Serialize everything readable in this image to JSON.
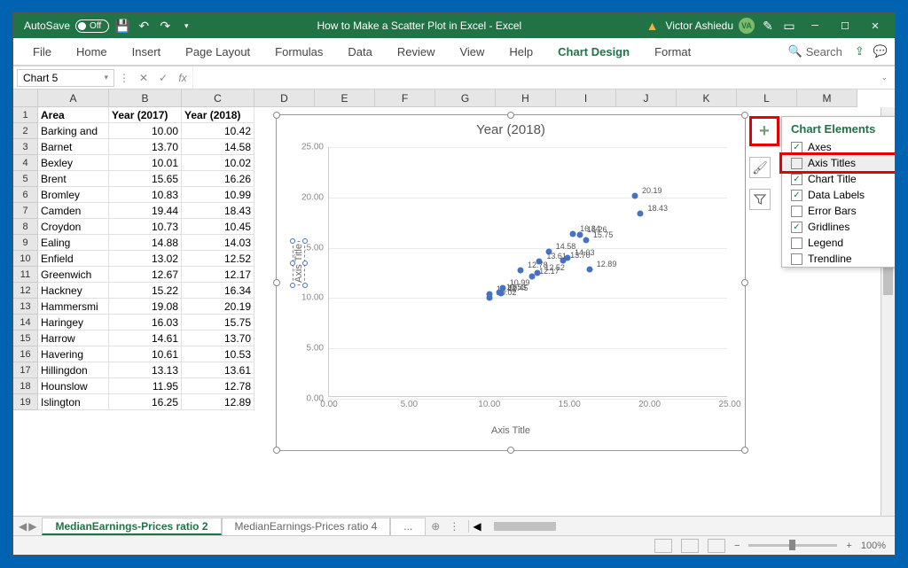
{
  "titlebar": {
    "autosave_label": "AutoSave",
    "autosave_state": "Off",
    "document_title": "How to Make a Scatter Plot in Excel  -  Excel",
    "user_name": "Victor Ashiedu",
    "user_initials": "VA"
  },
  "ribbon": {
    "tabs": [
      "File",
      "Home",
      "Insert",
      "Page Layout",
      "Formulas",
      "Data",
      "Review",
      "View",
      "Help",
      "Chart Design",
      "Format"
    ],
    "active_index": 9,
    "search_label": "Search"
  },
  "formulabar": {
    "namebox": "Chart 5"
  },
  "columns": [
    "",
    "A",
    "B",
    "C",
    "D",
    "E",
    "F",
    "G",
    "H",
    "I",
    "J",
    "K",
    "L",
    "M"
  ],
  "table": {
    "headers": [
      "Area",
      "Year (2017)",
      "Year (2018)"
    ],
    "rows": [
      [
        "Barking and",
        "10.00",
        "10.42"
      ],
      [
        "Barnet",
        "13.70",
        "14.58"
      ],
      [
        "Bexley",
        "10.01",
        "10.02"
      ],
      [
        "Brent",
        "15.65",
        "16.26"
      ],
      [
        "Bromley",
        "10.83",
        "10.99"
      ],
      [
        "Camden",
        "19.44",
        "18.43"
      ],
      [
        "Croydon",
        "10.73",
        "10.45"
      ],
      [
        "Ealing",
        "14.88",
        "14.03"
      ],
      [
        "Enfield",
        "13.02",
        "12.52"
      ],
      [
        "Greenwich",
        "12.67",
        "12.17"
      ],
      [
        "Hackney",
        "15.22",
        "16.34"
      ],
      [
        "Hammersmi",
        "19.08",
        "20.19"
      ],
      [
        "Haringey",
        "16.03",
        "15.75"
      ],
      [
        "Harrow",
        "14.61",
        "13.70"
      ],
      [
        "Havering",
        "10.61",
        "10.53"
      ],
      [
        "Hillingdon",
        "13.13",
        "13.61"
      ],
      [
        "Hounslow",
        "11.95",
        "12.78"
      ],
      [
        "Islington",
        "16.25",
        "12.89"
      ]
    ]
  },
  "chart_data": {
    "type": "scatter",
    "title": "Year (2018)",
    "xlabel": "Axis Title",
    "ylabel": "Axis Title",
    "x": [
      10.0,
      13.7,
      10.01,
      15.65,
      10.83,
      19.44,
      10.73,
      14.88,
      13.02,
      12.67,
      15.22,
      19.08,
      16.03,
      14.61,
      10.61,
      13.13,
      11.95,
      16.25
    ],
    "y": [
      10.42,
      14.58,
      10.02,
      16.26,
      10.99,
      18.43,
      10.45,
      14.03,
      12.52,
      12.17,
      16.34,
      20.19,
      15.75,
      13.7,
      10.53,
      13.61,
      12.78,
      12.89
    ],
    "xlim": [
      0,
      25
    ],
    "ylim": [
      0,
      25
    ],
    "xticks": [
      0,
      5,
      10,
      15,
      20,
      25
    ],
    "yticks": [
      0,
      5,
      10,
      15,
      20,
      25
    ],
    "data_labels_on": true
  },
  "chart_elements": {
    "title": "Chart Elements",
    "items": [
      {
        "label": "Axes",
        "checked": true
      },
      {
        "label": "Axis Titles",
        "checked": false,
        "highlight": true
      },
      {
        "label": "Chart Title",
        "checked": true
      },
      {
        "label": "Data Labels",
        "checked": true
      },
      {
        "label": "Error Bars",
        "checked": false
      },
      {
        "label": "Gridlines",
        "checked": true
      },
      {
        "label": "Legend",
        "checked": false
      },
      {
        "label": "Trendline",
        "checked": false
      }
    ]
  },
  "sheets": {
    "tabs": [
      "MedianEarnings-Prices ratio 2",
      "MedianEarnings-Prices ratio 4",
      "..."
    ],
    "active": 0
  },
  "status": {
    "zoom": "100%"
  }
}
